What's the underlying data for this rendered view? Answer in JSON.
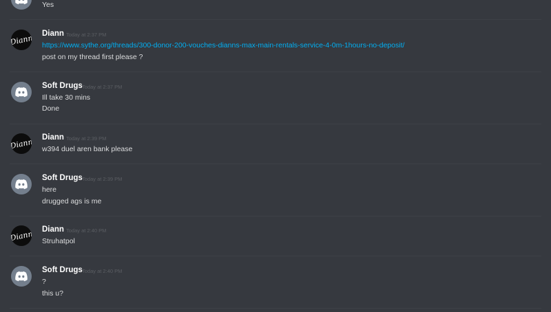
{
  "messages": [
    {
      "author": "",
      "timestamp": "",
      "avatar": "discord-default",
      "lines": [
        "Yes"
      ]
    },
    {
      "author": "Diann",
      "timestamp": "Today at 2:37 PM",
      "avatar": "diann-logo",
      "link": "https://www.sythe.org/threads/300-donor-200-vouches-dianns-max-main-rentals-service-4-0m-1hours-no-deposit/",
      "lines": [
        "post on my thread first please ?"
      ]
    },
    {
      "author": "Soft Drugs",
      "timestamp": "Today at 2:37 PM",
      "avatar": "discord-default",
      "lines": [
        "Ill take 30 mins",
        "Done"
      ]
    },
    {
      "author": "Diann",
      "timestamp": "Today at 2:39 PM",
      "avatar": "diann-logo",
      "lines": [
        "w394 duel aren bank please"
      ]
    },
    {
      "author": "Soft Drugs",
      "timestamp": "Today at 2:39 PM",
      "avatar": "discord-default",
      "lines": [
        "here",
        "drugged ags is me"
      ]
    },
    {
      "author": "Diann",
      "timestamp": "Today at 2:40 PM",
      "avatar": "diann-logo",
      "lines": [
        "Struhatpol"
      ]
    },
    {
      "author": "Soft Drugs",
      "timestamp": "Today at 2:40 PM",
      "avatar": "discord-default",
      "lines": [
        "?",
        "this u?"
      ]
    }
  ],
  "avatar_logo_text": "Diann",
  "colors": {
    "background": "#36393f",
    "divider": "#3e4147",
    "username": "#ffffff",
    "timestamp": "#5b5e63",
    "message_text": "#dcddde",
    "link": "#00b0f4",
    "discord_avatar": "#747f8d",
    "diann_avatar": "#0c0c0c"
  }
}
